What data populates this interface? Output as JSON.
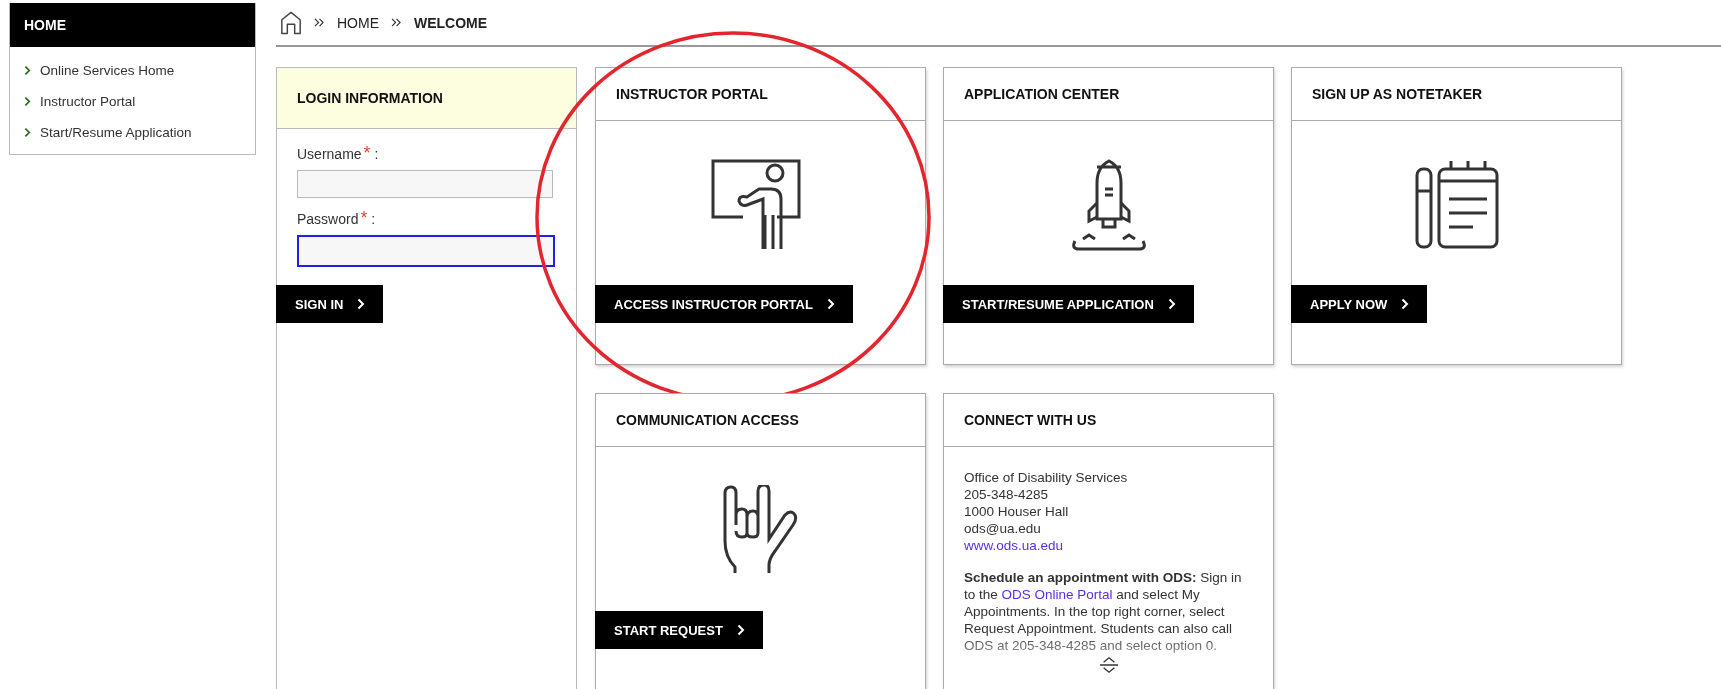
{
  "sidebar": {
    "title": "HOME",
    "items": [
      {
        "label": "Online Services Home"
      },
      {
        "label": "Instructor Portal"
      },
      {
        "label": "Start/Resume Application"
      }
    ]
  },
  "breadcrumb": [
    {
      "label": "HOME",
      "current": false
    },
    {
      "label": "WELCOME",
      "current": true
    }
  ],
  "login": {
    "title": "LOGIN INFORMATION",
    "fields": [
      {
        "label": "Username",
        "required_mark": "*",
        "separator": ":",
        "focused": false
      },
      {
        "label": "Password",
        "required_mark": "*",
        "separator": ":",
        "focused": true
      }
    ],
    "button": "SIGN IN"
  },
  "cards": [
    {
      "kind": "action",
      "title": "INSTRUCTOR PORTAL",
      "button": "ACCESS INSTRUCTOR PORTAL",
      "circled": true
    },
    {
      "kind": "action",
      "title": "APPLICATION CENTER",
      "button": "START/RESUME APPLICATION",
      "circled": false
    },
    {
      "kind": "action",
      "title": "SIGN UP AS NOTETAKER",
      "button": "APPLY NOW",
      "circled": false
    },
    {
      "kind": "action",
      "title": "COMMUNICATION ACCESS",
      "button": "START REQUEST",
      "circled": false
    },
    {
      "kind": "contact",
      "title": "CONNECT WITH US",
      "lines": [
        "Office of Disability Services",
        "205-348-4285",
        "1000 Houser Hall",
        "ods@ua.edu"
      ],
      "link": "www.ods.ua.edu",
      "paragraph_before": "**Schedule an appointment with ODS:** Sign in to the",
      "paragraph_link": "ODS Online Portal",
      "paragraph_after": "and select My Appointments. In the top right corner, select Request Appointment. Students can also call ODS at 205-348-4285 and select option 0."
    }
  ]
}
